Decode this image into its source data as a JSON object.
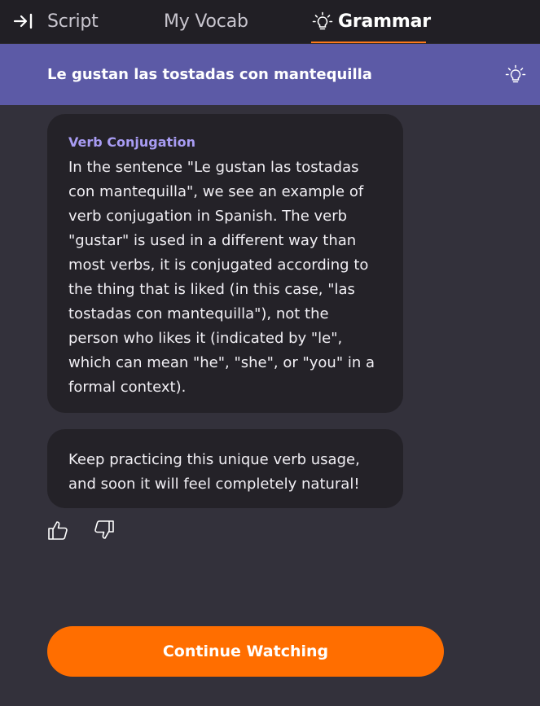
{
  "tabs": {
    "collapse_icon": "collapse-right-icon",
    "script": "Script",
    "vocab": "My Vocab",
    "grammar": "Grammar",
    "grammar_icon": "lightbulb-icon",
    "active": "Grammar",
    "accent_color": "#ff7a1a"
  },
  "header": {
    "title": "Le gustan las tostadas con mantequilla",
    "icon": "lightbulb-icon",
    "background_color": "#5c5aa6"
  },
  "messages": [
    {
      "heading": "Verb Conjugation",
      "body": "In the sentence \"Le gustan las tostadas con mantequilla\", we see an example of verb conjugation in Spanish. The verb \"gustar\" is used in a different way than most verbs, it is conjugated according to the thing that is liked (in this case, \"las tostadas con mantequilla\"), not the person who likes it (indicated by \"le\", which can mean \"he\", \"she\", or \"you\" in a formal context)."
    },
    {
      "body": "Keep practicing this unique verb usage, and soon it will feel completely natural!"
    }
  ],
  "feedback": {
    "like_icon": "thumbs-up-icon",
    "dislike_icon": "thumbs-down-icon"
  },
  "cta": {
    "label": "Continue Watching",
    "color": "#ff6e00"
  }
}
